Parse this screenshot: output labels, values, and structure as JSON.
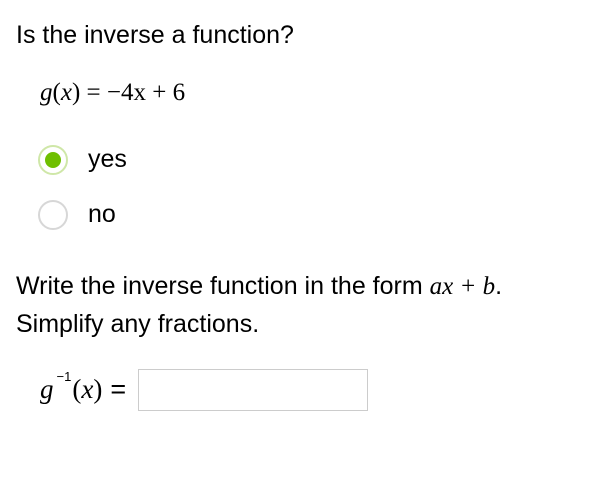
{
  "question": {
    "title": "Is the inverse a function?",
    "equation": {
      "lhs_func": "g",
      "lhs_var": "x",
      "rhs": "−4x + 6"
    },
    "options": [
      {
        "label": "yes",
        "selected": true
      },
      {
        "label": "no",
        "selected": false
      }
    ]
  },
  "instruction": {
    "prefix": "Write the inverse function in the form",
    "form": "ax + b",
    "suffix": ". Simplify any fractions."
  },
  "answer": {
    "func": "g",
    "exponent": "−1",
    "var": "x",
    "value": ""
  },
  "colors": {
    "accent": "#6fbf00"
  }
}
